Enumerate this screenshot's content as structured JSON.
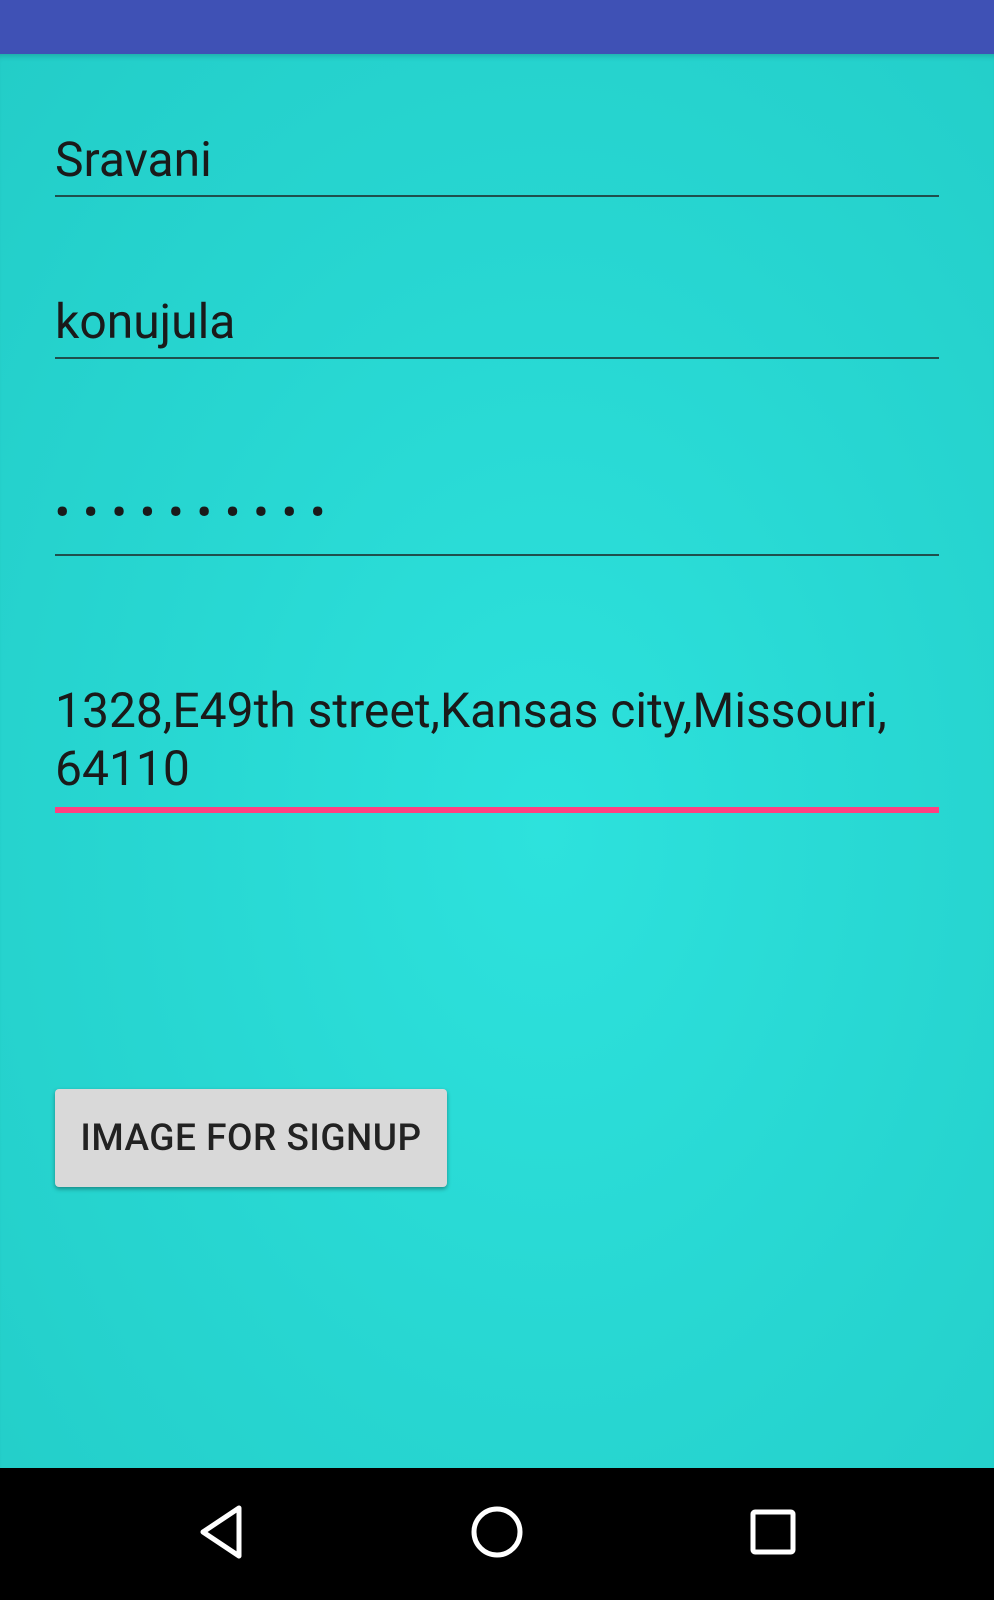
{
  "form": {
    "first_name_value": "Sravani",
    "last_name_value": "konujula",
    "password_masked": "••••••••••",
    "address_line1": "1328,E49th street,Kansas city,Missouri,",
    "address_line2": "64110",
    "button_label": "IMAGE FOR SIGNUP"
  },
  "colors": {
    "status_bar": "#3F51B5",
    "background": "#27D6D1",
    "focus_accent": "#FF4081",
    "button": "#D9D9D9",
    "nav_bar": "#000000"
  },
  "nav": {
    "icons": [
      "back-icon",
      "home-icon",
      "recents-icon"
    ]
  }
}
